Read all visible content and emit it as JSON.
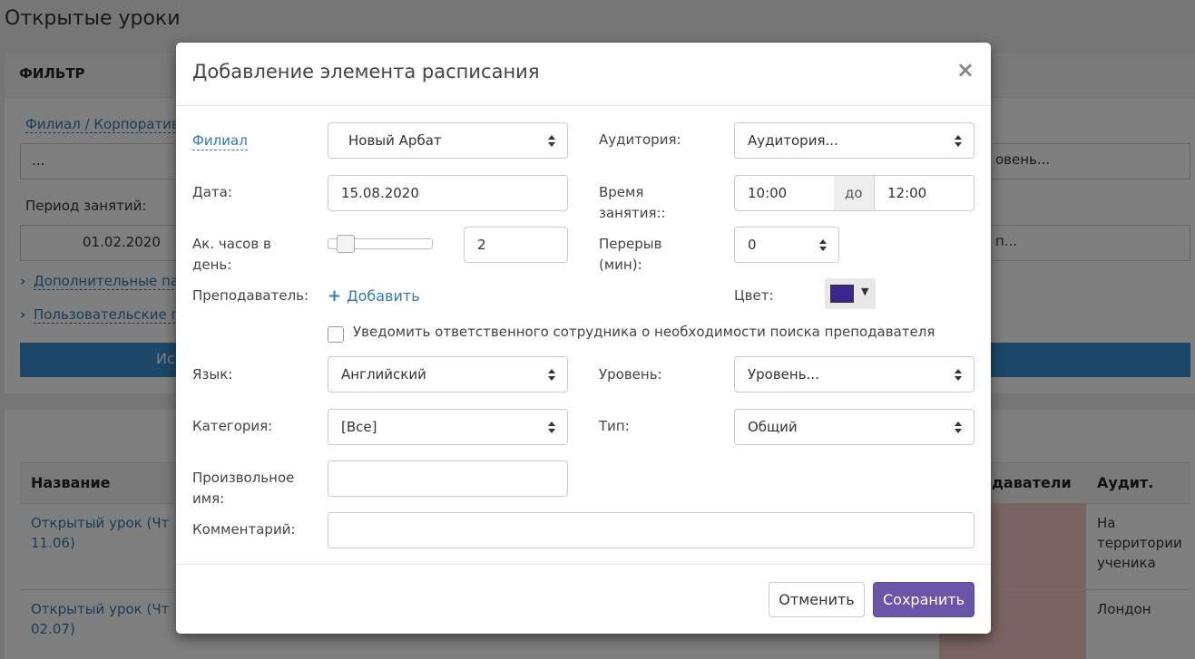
{
  "background": {
    "page_title": "Открытые уроки",
    "filter": {
      "header": "ФИЛЬТР",
      "branch_link": "Филиал / Корпоратив",
      "branch_value": "...",
      "period_label": "Период занятий:",
      "period_from": "01.02.2020",
      "extra_params": "Дополнительные па",
      "user_params": "Пользовательские п",
      "search_button": "Ис",
      "right_select_1": "овень...",
      "right_select_2": "п..."
    },
    "table": {
      "col_name": "Название",
      "col_teachers": "одаватели",
      "col_room": "Аудит.",
      "rows": [
        {
          "name": "Открытый урок (Чт 11.06)",
          "room": "На территории ученика"
        },
        {
          "name": "Открытый урок (Чт 02.07)",
          "room": "Лондон"
        }
      ]
    }
  },
  "modal": {
    "title": "Добавление элемента расписания",
    "close_symbol": "×",
    "branch_label": "Филиал",
    "branch_value": "Новый Арбат",
    "room_label": "Аудитория:",
    "room_value": "Аудитория...",
    "date_label": "Дата:",
    "date_value": "15.08.2020",
    "time_label_1": "Время",
    "time_label_2": "занятия::",
    "time_from": "10:00",
    "time_to_word": "до",
    "time_to": "12:00",
    "hours_label_1": "Ак. часов в",
    "hours_label_2": "день:",
    "hours_value": "2",
    "hours_slider_level": 0.1,
    "break_label_1": "Перерыв",
    "break_label_2": "(мин):",
    "break_value": "0",
    "teacher_label": "Преподаватель:",
    "add_teacher": "Добавить",
    "color_label": "Цвет:",
    "color_value": "#3d2590",
    "notify_label": "Уведомить ответственного сотрудника о необходимости поиска преподавателя",
    "notify_checked": false,
    "language_label": "Язык:",
    "language_value": "Английский",
    "level_label": "Уровень:",
    "level_value": "Уровень...",
    "category_label": "Категория:",
    "category_value": "[Все]",
    "type_label": "Тип:",
    "type_value": "Общий",
    "custom_name_label_1": "Произвольное",
    "custom_name_label_2": "имя:",
    "custom_name_value": "",
    "comment_label": "Комментарий:",
    "comment_value": "",
    "cancel_button": "Отменить",
    "save_button": "Сохранить"
  },
  "colors": {
    "link": "#3479b7",
    "primary": "#6a55a8",
    "overlay": "rgba(0,0,0,0.5)",
    "highlight_pink": "#f7c6c6"
  }
}
